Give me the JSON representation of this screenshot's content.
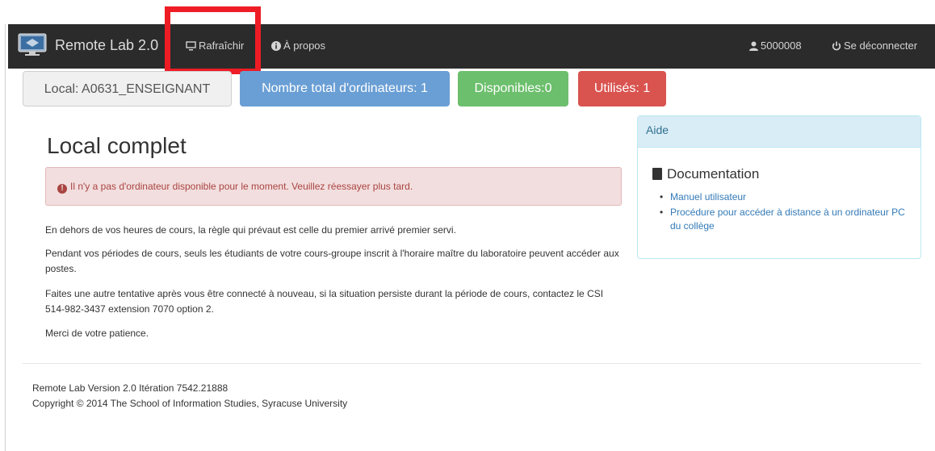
{
  "navbar": {
    "brand": "Remote Lab 2.0",
    "refresh_label": "Rafraîchir",
    "about_label": "À propos",
    "user_id": "5000008",
    "logout_label": "Se déconnecter"
  },
  "status": {
    "local": "Local: A0631_ENSEIGNANT",
    "total": "Nombre total d'ordinateurs: 1",
    "available": "Disponibles:0",
    "used": "Utilisés: 1"
  },
  "main": {
    "title": "Local complet",
    "alert": "Il n'y a pas d'ordinateur disponible pour le moment. Veuillez réessayer plus tard.",
    "paragraphs": [
      "En dehors de vos heures de cours, la règle qui prévaut est celle du premier arrivé premier servi.",
      "Pendant vos périodes de cours, seuls les étudiants de votre cours-groupe inscrit à l'horaire maître du laboratoire peuvent accéder aux postes.",
      "Faites une autre tentative après vous être connecté à nouveau, si la situation persiste durant la période de cours, contactez le CSI 514-982-3437 extension 7070 option 2.",
      "Merci de votre patience."
    ]
  },
  "help_panel": {
    "heading": "Aide",
    "doc_title": "Documentation",
    "links": [
      "Manuel utilisateur",
      "Procédure pour accéder à distance à un ordinateur PC du collège"
    ]
  },
  "footer": {
    "version": "Remote Lab Version 2.0 Itération 7542.21888",
    "copyright": "Copyright © 2014 The School of Information Studies, Syracuse University"
  },
  "colors": {
    "navbar_bg": "#2b2b2b",
    "primary": "#6a9fd5",
    "success": "#6cbf6c",
    "danger": "#d9534f",
    "highlight": "#ee1c25"
  },
  "icons": [
    "monitor-logo-icon",
    "monitor-icon",
    "info-icon",
    "user-icon",
    "power-icon",
    "exclamation-icon",
    "book-icon"
  ]
}
